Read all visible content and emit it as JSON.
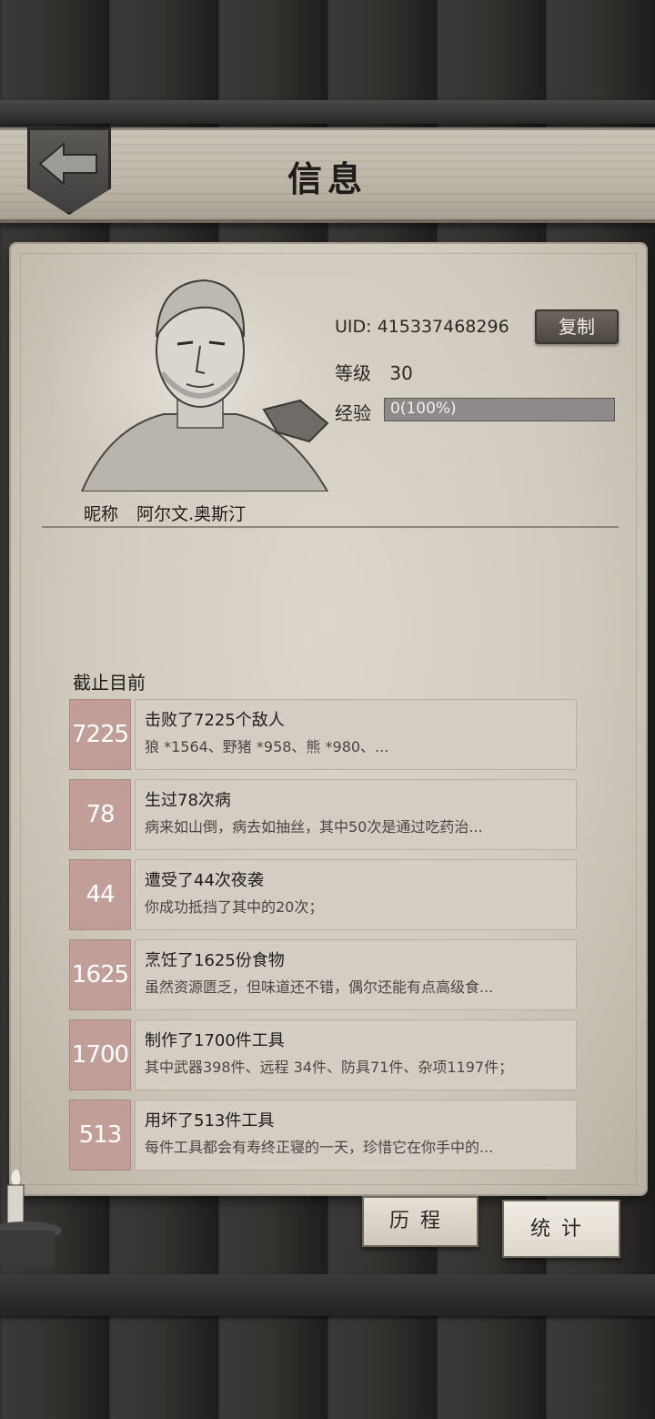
{
  "header": {
    "title": "信息",
    "back_icon": "back-arrow-icon"
  },
  "profile": {
    "uid_label": "UID:",
    "uid_value": "415337468296",
    "copy_label": "复制",
    "level_label": "等级",
    "level_value": "30",
    "exp_label": "经验",
    "exp_text": "0(100%)",
    "exp_fraction": 1.0,
    "nickname_label": "昵称",
    "nickname_value": "阿尔文.奥斯汀"
  },
  "stats": {
    "section_title": "截止目前",
    "items": [
      {
        "number": "7225",
        "title": "击败了7225个敌人",
        "desc": "狼 *1564、野猪 *958、熊 *980、..."
      },
      {
        "number": "78",
        "title": "生过78次病",
        "desc": "病来如山倒，病去如抽丝，其中50次是通过吃药治..."
      },
      {
        "number": "44",
        "title": "遭受了44次夜袭",
        "desc": "你成功抵挡了其中的20次；"
      },
      {
        "number": "1625",
        "title": "烹饪了1625份食物",
        "desc": "虽然资源匮乏，但味道还不错，偶尔还能有点高级食..."
      },
      {
        "number": "1700",
        "title": "制作了1700件工具",
        "desc": "其中武器398件、远程 34件、防具71件、杂项1197件；"
      },
      {
        "number": "513",
        "title": "用坏了513件工具",
        "desc": "每件工具都会有寿终正寝的一天，珍惜它在你手中的..."
      }
    ]
  },
  "tabs": {
    "history_label": "历程",
    "stats_label": "统计"
  },
  "colors": {
    "stat_number_bg": "#c19f98",
    "exp_bar": "#8d8a89",
    "copy_button": "#5d5650"
  }
}
